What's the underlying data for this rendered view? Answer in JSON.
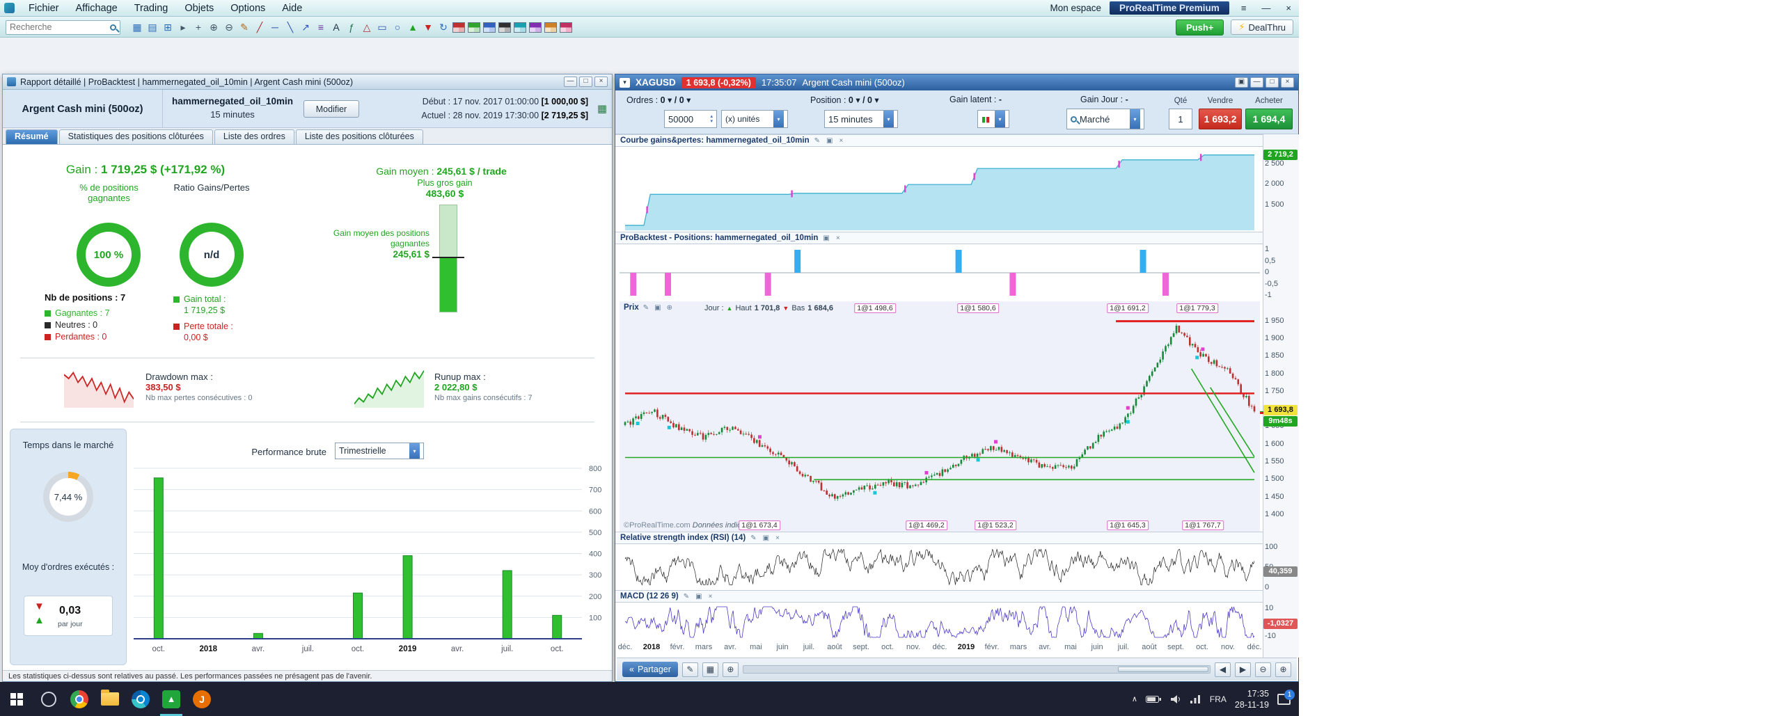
{
  "colors": {
    "green": "#2db52d",
    "red": "#cc2222",
    "blue": "#2f6cb8",
    "gauge_accent": "#f5a623",
    "gauge_track": "#d4dae1"
  },
  "icons": {
    "dropdown": "▾",
    "spin_up": "▴",
    "spin_down": "▾",
    "pencil": "✎",
    "panel": "▣",
    "close": "×",
    "plus": "⊕",
    "minus": "⊖",
    "left": "◀",
    "right": "▶",
    "up": "▲",
    "down": "▼",
    "burger": "≡",
    "bolt": "⚡",
    "share": "«",
    "grid": "▦",
    "minimize": "—",
    "maximize": "□",
    "chevron_up": "∧",
    "report": "▦"
  },
  "menubar": {
    "menus": [
      "Fichier",
      "Affichage",
      "Trading",
      "Objets",
      "Options",
      "Aide"
    ],
    "mon_espace": "Mon espace",
    "premium": "ProRealTime Premium"
  },
  "toolbar": {
    "search_placeholder": "Recherche",
    "push_label": "Push+",
    "dealthru_label": "DealThru",
    "icons": [
      {
        "name": "workspace-icon",
        "glyph": "▦",
        "color": "#2f6cb8"
      },
      {
        "name": "watchlist-icon",
        "glyph": "▤",
        "color": "#2f6cb8"
      },
      {
        "name": "new-chart-icon",
        "glyph": "⊞",
        "color": "#2f6cb8"
      },
      {
        "name": "pointer-icon",
        "glyph": "▸",
        "color": "#445566"
      },
      {
        "name": "crosshair-icon",
        "glyph": "+",
        "color": "#445566"
      },
      {
        "name": "zoom-in-icon",
        "glyph": "⊕",
        "color": "#445566"
      },
      {
        "name": "zoom-out-icon",
        "glyph": "⊖",
        "color": "#445566"
      },
      {
        "name": "pencil-icon",
        "glyph": "✎",
        "color": "#b06a1e"
      },
      {
        "name": "trendline-icon",
        "glyph": "╱",
        "color": "#b03030"
      },
      {
        "name": "horizontal-line-icon",
        "glyph": "─",
        "color": "#3056b0"
      },
      {
        "name": "segment-icon",
        "glyph": "╲",
        "color": "#3056b0"
      },
      {
        "name": "arrow-line-icon",
        "glyph": "↗",
        "color": "#3056b0"
      },
      {
        "name": "fibonacci-icon",
        "glyph": "≡",
        "color": "#7030a0"
      },
      {
        "name": "text-icon",
        "glyph": "A",
        "color": "#223344"
      },
      {
        "name": "function-icon",
        "glyph": "ƒ",
        "color": "#207050"
      },
      {
        "name": "triangle-icon",
        "glyph": "△",
        "color": "#b03030"
      },
      {
        "name": "rectangle-icon",
        "glyph": "▭",
        "color": "#3056b0"
      },
      {
        "name": "ellipse-icon",
        "glyph": "○",
        "color": "#3056b0"
      },
      {
        "name": "buy-arrow-icon",
        "glyph": "▲",
        "color": "#1fa51f"
      },
      {
        "name": "sell-arrow-icon",
        "glyph": "▼",
        "color": "#cc2222"
      },
      {
        "name": "refresh-icon",
        "glyph": "↻",
        "color": "#2f6cb8"
      }
    ],
    "layout_icons": [
      {
        "name": "layout-preset-1-icon",
        "colors": [
          "#c03030",
          "#e8b0b0",
          "#f0d0d0",
          "#c03030"
        ]
      },
      {
        "name": "layout-preset-2-icon",
        "colors": [
          "#2fa52f",
          "#b8e0b8",
          "#d8f0d8",
          "#2fa52f"
        ]
      },
      {
        "name": "layout-preset-3-icon",
        "colors": [
          "#3060c0",
          "#b0c8f0",
          "#d0e0f8",
          "#3060c0"
        ]
      },
      {
        "name": "layout-preset-4-icon",
        "colors": [
          "#303030",
          "#b0b0b0",
          "#d8d8d8",
          "#303030"
        ]
      },
      {
        "name": "layout-preset-5-icon",
        "colors": [
          "#18a0b0",
          "#a8dce4",
          "#ccedf2",
          "#18a0b0"
        ]
      },
      {
        "name": "layout-preset-6-icon",
        "colors": [
          "#8030b0",
          "#d0b0e8",
          "#e6d4f4",
          "#8030b0"
        ]
      },
      {
        "name": "layout-preset-7-icon",
        "colors": [
          "#d08020",
          "#f0d0a0",
          "#f8e6cc",
          "#d08020"
        ]
      },
      {
        "name": "layout-preset-8-icon",
        "colors": [
          "#c03060",
          "#f0b0c8",
          "#f8d4e2",
          "#c03060"
        ]
      }
    ]
  },
  "report_window": {
    "title": "Rapport détaillé | ProBacktest | hammernegated_oil_10min | Argent Cash mini (500oz)",
    "instrument": "Argent Cash mini (500oz)",
    "strategy_name": "hammernegated_oil_10min",
    "strategy_timeframe": "15 minutes",
    "modify_button": "Modifier",
    "start_label": "Début :",
    "start_datetime": "17 nov. 2017 01:00:00",
    "start_capital": "[1 000,00 $]",
    "current_label": "Actuel :",
    "current_datetime": "28 nov. 2019 17:30:00",
    "current_capital": "[2 719,25 $]",
    "tabs": [
      "Résumé",
      "Statistiques des positions clôturées",
      "Liste des ordres",
      "Liste des positions clôturées"
    ],
    "active_tab_index": 0,
    "gain_label": "Gain :",
    "gain_value": "1 719,25 $ (+171,92 %)",
    "gain_moyen_label": "Gain moyen :",
    "gain_moyen_value": "245,61 $ / trade",
    "pct_gagnantes_label": "% de positions gagnantes",
    "pct_gagnantes_value": "100 %",
    "ratio_label": "Ratio Gains/Pertes",
    "ratio_value": "n/d",
    "plus_gros_gain_label": "Plus gros gain",
    "plus_gros_gain_value": "483,60 $",
    "gain_moyen_gagnantes_label": "Gain moyen des positions gagnantes",
    "gain_moyen_gagnantes_value": "245,61 $",
    "gauge_pct": 50.8,
    "nb_positions_label": "Nb de positions : 7",
    "legend": [
      {
        "label": "Gagnantes : 7",
        "color": "#2db52d"
      },
      {
        "label": "Neutres : 0",
        "color": "#2a2a2a"
      },
      {
        "label": "Perdantes : 0",
        "color": "#cc2222"
      }
    ],
    "gain_total_label": "Gain total :",
    "gain_total_value": "1 719,25 $",
    "perte_totale_label": "Perte totale :",
    "perte_totale_value": "0,00 $",
    "drawdown_label": "Drawdown max :",
    "drawdown_value": "383,50 $",
    "drawdown_sub": "Nb max pertes consécutives : 0",
    "runup_label": "Runup max :",
    "runup_value": "2 022,80 $",
    "runup_sub": "Nb max gains consécutifs : 7",
    "temps_marche_label": "Temps dans le marché",
    "temps_marche_value": "7,44 %",
    "temps_marche_pct": 7.44,
    "perf_label": "Performance brute",
    "perf_period": "Trimestrielle",
    "moy_ordres_label": "Moy d'ordres exécutés :",
    "moy_ordres_value": "0,03",
    "moy_ordres_unit": "par jour",
    "footer": "Les statistiques ci-dessus sont relatives au passé. Les performances passées ne présagent pas de l'avenir."
  },
  "chart_window": {
    "symbol": "XAGUSD",
    "price_badge": "1 693,8 (-0,32%)",
    "title_time": "17:35:07",
    "title_instrument": "Argent Cash mini (500oz)",
    "trade_info": [
      {
        "label": "Ordres :",
        "value": "0 / 0"
      },
      {
        "label": "Position :",
        "value": "0 / 0"
      },
      {
        "label": "Gain latent :",
        "value": "-"
      },
      {
        "label": "Gain Jour :",
        "value": "-"
      }
    ],
    "qty_value": "50000",
    "qty_unit": "(x) unités",
    "timeframe": "15 minutes",
    "order_type": "Marché",
    "qte_label": "Qté",
    "qte_value": "1",
    "sell_label": "Vendre",
    "sell_price": "1 693,2",
    "buy_label": "Acheter",
    "buy_price": "1 694,4",
    "panel_equity_title": "Courbe gains&pertes: hammernegated_oil_10min",
    "panel_positions_title": "ProBacktest - Positions: hammernegated_oil_10min",
    "panel_price_title": "Prix",
    "day_label": "Jour :",
    "day_high_label": "Haut",
    "day_high": "1 701,8",
    "day_low_label": "Bas",
    "day_low": "1 684,6",
    "current_price": "1 693,8",
    "countdown": "9m48s",
    "rsi_title": "Relative strength index (RSI) (14)",
    "macd_title": "MACD (12 26 9)",
    "watermark": "©ProRealTime.com",
    "watermark2": "Données indicatives",
    "share_button": "Partager",
    "months": [
      "déc.",
      "2018",
      "févr.",
      "mars",
      "avr.",
      "mai",
      "juin",
      "juil.",
      "août",
      "sept.",
      "oct.",
      "nov.",
      "déc.",
      "2019",
      "févr.",
      "mars",
      "avr.",
      "mai",
      "juin",
      "juil.",
      "août",
      "sept.",
      "oct.",
      "nov.",
      "déc."
    ]
  },
  "chart_data": [
    {
      "id": "quarterly_performance",
      "type": "bar",
      "title": "Performance brute (Trimestrielle)",
      "categories": [
        "oct.",
        "2018",
        "avr.",
        "juil.",
        "oct.",
        "2019",
        "avr.",
        "juil.",
        "oct."
      ],
      "values": [
        755,
        0,
        25,
        0,
        215,
        390,
        0,
        320,
        110
      ],
      "ylim": [
        0,
        800
      ],
      "yticks": [
        100,
        200,
        300,
        400,
        500,
        600,
        700,
        800
      ],
      "bar_color": "#2fbf2f",
      "xlabel": "",
      "ylabel": ""
    },
    {
      "id": "equity_curve",
      "type": "area",
      "title": "Courbe gains&pertes: hammernegated_oil_10min",
      "points": [
        [
          0,
          1005
        ],
        [
          0.03,
          1005
        ],
        [
          0.04,
          1760
        ],
        [
          0.26,
          1760
        ],
        [
          0.27,
          1785
        ],
        [
          0.44,
          1785
        ],
        [
          0.45,
          2000
        ],
        [
          0.55,
          2000
        ],
        [
          0.56,
          2390
        ],
        [
          0.78,
          2390
        ],
        [
          0.79,
          2600
        ],
        [
          0.91,
          2600
        ],
        [
          0.92,
          2719
        ],
        [
          1,
          2719
        ]
      ],
      "ylim": [
        950,
        2850
      ],
      "yticks": [
        "2 500",
        "2 000",
        "1 500"
      ],
      "current_label": "2 719,2",
      "step_marks": [
        0.035,
        0.265,
        0.445,
        0.555,
        0.785,
        0.915
      ],
      "fill": "#b5e3f2",
      "stroke": "#3fb0d0"
    },
    {
      "id": "positions",
      "type": "bar",
      "title": "ProBacktest - Positions: hammernegated_oil_10min",
      "long_x": [
        0.274,
        0.53,
        0.823
      ],
      "short_x": [
        0.013,
        0.068,
        0.227,
        0.616,
        0.859
      ],
      "yticks": [
        "1",
        "0,5",
        "0",
        "-0,5",
        "-1"
      ],
      "long_color": "#35aef0",
      "short_color": "#f065d8"
    },
    {
      "id": "price",
      "type": "candlestick",
      "title": "Prix — XAGUSD Argent Cash mini (500oz), 15 minutes",
      "ylim": [
        1390,
        1975
      ],
      "yticks": [
        "1 950",
        "1 900",
        "1 850",
        "1 800",
        "1 750",
        "1 700",
        "1 650",
        "1 600",
        "1 550",
        "1 500",
        "1 450",
        "1 400"
      ],
      "current": 1693.8,
      "monthly_anchors": [
        1655,
        1698,
        1648,
        1622,
        1650,
        1608,
        1562,
        1505,
        1448,
        1472,
        1492,
        1482,
        1518,
        1562,
        1592,
        1562,
        1538,
        1532,
        1618,
        1662,
        1788,
        1932,
        1852,
        1808,
        1694
      ],
      "lines": [
        {
          "type": "h",
          "y": 1745,
          "x1": 0,
          "x2": 1,
          "color": "#e02020",
          "w": 2.5
        },
        {
          "type": "h",
          "y": 1950,
          "x1": 0.78,
          "x2": 1,
          "color": "#e02020",
          "w": 3
        },
        {
          "type": "h",
          "y": 1563,
          "x1": 0,
          "x2": 1,
          "color": "#22a822",
          "w": 1.6
        },
        {
          "type": "h",
          "y": 1500,
          "x1": 0.3,
          "x2": 1,
          "color": "#22a822",
          "w": 1.6
        },
        {
          "type": "seg",
          "x1": 0.9,
          "y1": 1815,
          "x2": 1,
          "y2": 1520,
          "color": "#22a822",
          "w": 1.6
        },
        {
          "type": "seg",
          "x1": 0.93,
          "y1": 1762,
          "x2": 1,
          "y2": 1565,
          "color": "#22a822",
          "w": 1.6
        }
      ],
      "entry_labels": [
        {
          "x": 0.397,
          "text": "1@1 498,6"
        },
        {
          "x": 0.561,
          "text": "1@1 580,6"
        },
        {
          "x": 0.799,
          "text": "1@1 691,2"
        },
        {
          "x": 0.909,
          "text": "1@1 779,3"
        }
      ],
      "exit_labels": [
        {
          "x": 0.214,
          "text": "1@1 673,4"
        },
        {
          "x": 0.479,
          "text": "1@1 469,2"
        },
        {
          "x": 0.589,
          "text": "1@1 523,2"
        },
        {
          "x": 0.799,
          "text": "1@1 645,3"
        },
        {
          "x": 0.918,
          "text": "1@1 767,7"
        }
      ],
      "extra_markers": [
        0.02,
        0.07
      ]
    },
    {
      "id": "rsi",
      "type": "line",
      "title": "Relative strength index (RSI) (14)",
      "range": [
        0,
        100
      ],
      "yticks": [
        "100",
        "50",
        "0"
      ],
      "current_label": "40,359",
      "color": "#222222"
    },
    {
      "id": "macd",
      "type": "line",
      "title": "MACD (12 26 9)",
      "range": [
        -12,
        12
      ],
      "yticks": [
        "10",
        "0",
        "-10"
      ],
      "current_label": "-1,0327",
      "color": "#4a3ac8"
    },
    {
      "id": "drawdown_spark",
      "type": "area",
      "y_points_top": [
        6,
        10,
        4,
        14,
        8,
        18,
        10,
        22,
        14,
        26,
        16,
        30,
        20,
        34,
        24,
        31
      ],
      "color": "#cc2222"
    },
    {
      "id": "runup_spark",
      "type": "area",
      "y_points_top": [
        36,
        30,
        34,
        26,
        30,
        20,
        26,
        16,
        22,
        12,
        18,
        8,
        14,
        4,
        10,
        2
      ],
      "color": "#1fa51f"
    }
  ],
  "taskbar": {
    "tray_lang": "FRA",
    "time": "17:35",
    "date": "28-11-19",
    "badge": "1"
  }
}
